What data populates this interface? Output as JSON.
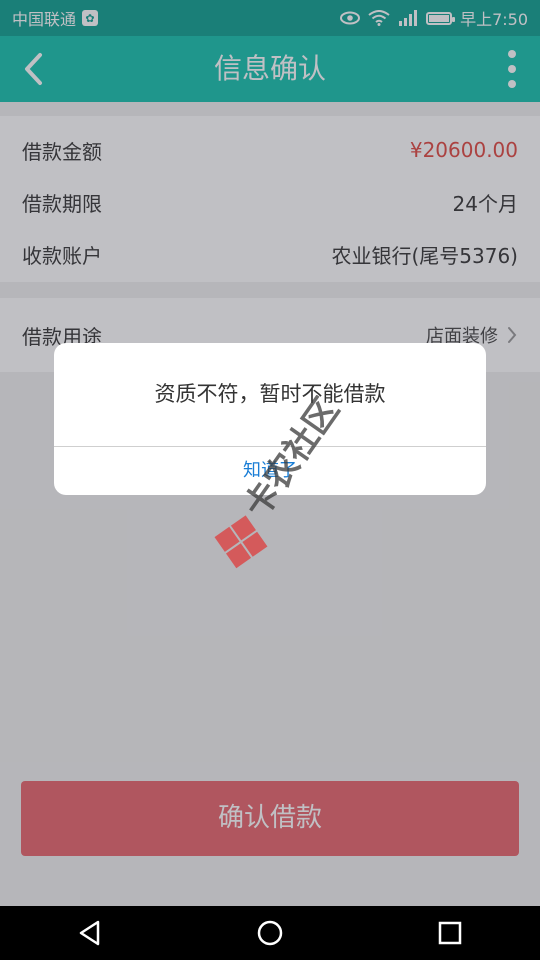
{
  "status_bar": {
    "carrier": "中国联通",
    "time": "早上7:50"
  },
  "app_bar": {
    "title": "信息确认",
    "icons": [
      "back-icon",
      "more-vertical-icon"
    ]
  },
  "loan_info": {
    "rows": [
      {
        "label": "借款金额",
        "value": "¥20600.00",
        "value_color": "#e0463e"
      },
      {
        "label": "借款期限",
        "value": "24个月"
      },
      {
        "label": "收款账户",
        "value": "农业银行(尾号5376)"
      }
    ]
  },
  "purpose": {
    "label": "借款用途",
    "value": "店面装修"
  },
  "confirm_button": {
    "label": "确认借款",
    "color": "#e8636a"
  },
  "dialog": {
    "message": "资质不符，暂时不能借款",
    "ok_label": "知道了"
  },
  "watermark": {
    "text": "卡农社区"
  },
  "colors": {
    "status_bar": "#0b9f8f",
    "app_bar": "#12c2ad",
    "accent_red": "#e0463e",
    "link_blue": "#1a7ed6"
  }
}
